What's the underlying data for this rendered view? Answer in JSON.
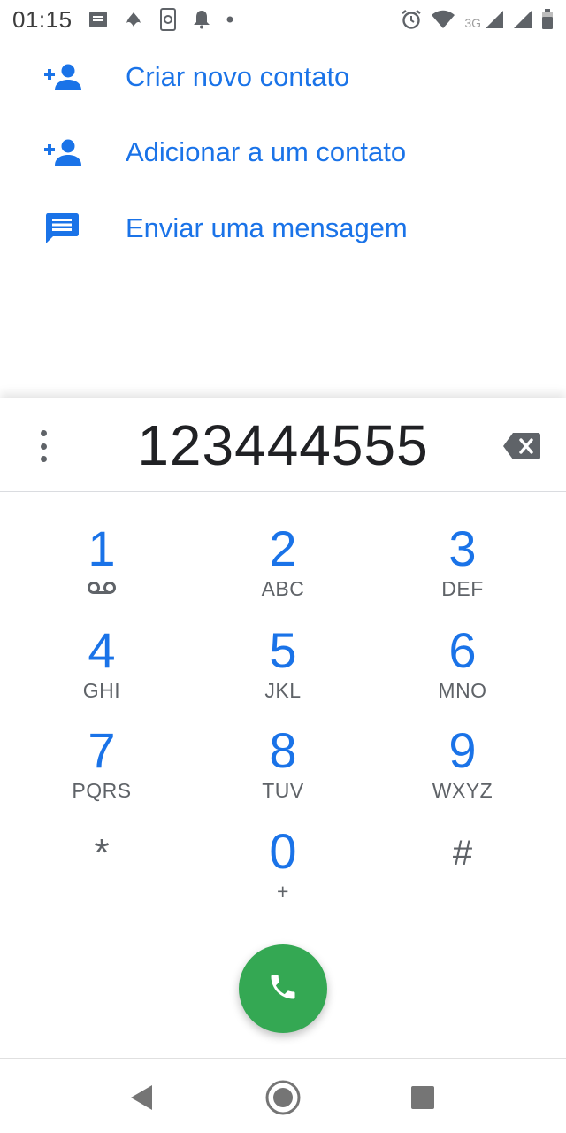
{
  "status_bar": {
    "time": "01:15",
    "network_type": "3G",
    "left_icons": [
      "notification-message-icon",
      "app-notification-icon",
      "phone-sync-icon",
      "bell-icon",
      "dot-icon"
    ],
    "right_icons": [
      "alarm-icon",
      "wifi-icon",
      "signal-icon",
      "signal-icon",
      "battery-icon"
    ]
  },
  "suggestions": [
    {
      "icon": "add-person-icon",
      "label": "Criar novo contato"
    },
    {
      "icon": "add-person-icon",
      "label": "Adicionar a um contato"
    },
    {
      "icon": "message-icon",
      "label": "Enviar uma mensagem"
    }
  ],
  "dialpad": {
    "entered_number": "123444555",
    "keys": [
      {
        "digit": "1",
        "letters": "",
        "sub_icon": "voicemail-icon"
      },
      {
        "digit": "2",
        "letters": "ABC"
      },
      {
        "digit": "3",
        "letters": "DEF"
      },
      {
        "digit": "4",
        "letters": "GHI"
      },
      {
        "digit": "5",
        "letters": "JKL"
      },
      {
        "digit": "6",
        "letters": "MNO"
      },
      {
        "digit": "7",
        "letters": "PQRS"
      },
      {
        "digit": "8",
        "letters": "TUV"
      },
      {
        "digit": "9",
        "letters": "WXYZ"
      },
      {
        "digit": "*",
        "letters": ""
      },
      {
        "digit": "0",
        "letters": "+"
      },
      {
        "digit": "#",
        "letters": ""
      }
    ]
  },
  "colors": {
    "accent_blue": "#1a73e8",
    "call_green": "#34a853",
    "icon_grey": "#5f6368"
  },
  "nav_bar": {
    "buttons": [
      "back-icon",
      "home-icon",
      "recents-icon"
    ]
  }
}
